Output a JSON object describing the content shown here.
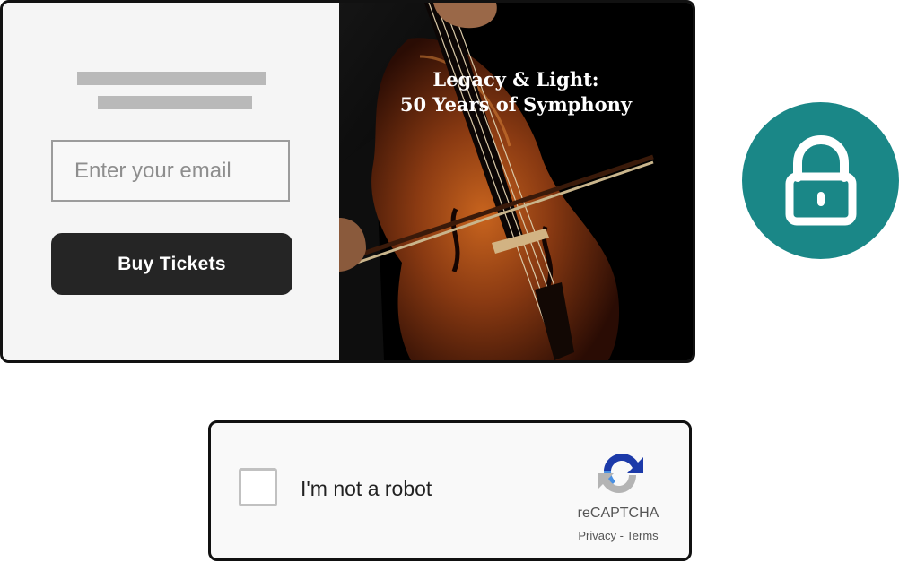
{
  "promo": {
    "email_placeholder": "Enter your email",
    "buy_button_label": "Buy Tickets",
    "event_title_line1": "Legacy & Light:",
    "event_title_line2": "50 Years of Symphony",
    "image_subject": "cello-and-bow"
  },
  "lock_badge": {
    "icon": "lock-icon",
    "color": "#1a8787"
  },
  "captcha": {
    "label": "I'm not a robot",
    "checked": false,
    "brand": "reCAPTCHA",
    "privacy_label": "Privacy",
    "separator": " - ",
    "terms_label": "Terms",
    "logo_icon": "recaptcha-logo-icon"
  },
  "colors": {
    "button_bg": "#252525",
    "badge_bg": "#1a8787",
    "recaptcha_blue": "#1c3aa9",
    "recaptcha_light_blue": "#4a90e2",
    "recaptcha_gray": "#b4b4b4"
  }
}
